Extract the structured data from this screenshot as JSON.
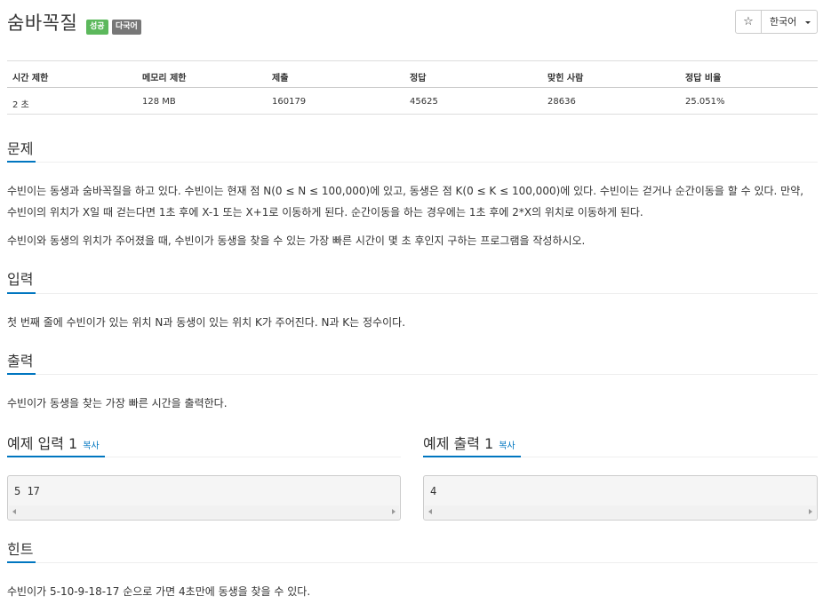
{
  "problem": {
    "title": "숨바꼭질",
    "badges": [
      "성공",
      "다국어"
    ]
  },
  "toolbar": {
    "star": "☆",
    "language": "한국어"
  },
  "stats": {
    "headers": [
      "시간 제한",
      "메모리 제한",
      "제출",
      "정답",
      "맞힌 사람",
      "정답 비율"
    ],
    "values": [
      "2 초",
      "128 MB",
      "160179",
      "45625",
      "28636",
      "25.051%"
    ]
  },
  "sections": {
    "description": {
      "heading": "문제",
      "p1_line1": "수빈이는 동생과 숨바꼭질을 하고 있다. 수빈이는 현재 점 N(0 ≤ N ≤ 100,000)에 있고, 동생은 점 K(0 ≤ K ≤ 100,000)에 있다. 수빈이는 걷거나 순간이동을 할 수 있다. 만약,",
      "p1_line2": "수빈이의 위치가 X일 때 걷는다면 1초 후에 X-1 또는 X+1로 이동하게 된다. 순간이동을 하는 경우에는 1초 후에 2*X의 위치로 이동하게 된다.",
      "p2": "수빈이와 동생의 위치가 주어졌을 때, 수빈이가 동생을 찾을 수 있는 가장 빠른 시간이 몇 초 후인지 구하는 프로그램을 작성하시오."
    },
    "input": {
      "heading": "입력",
      "text": "첫 번째 줄에 수빈이가 있는 위치 N과 동생이 있는 위치 K가 주어진다. N과 K는 정수이다."
    },
    "output": {
      "heading": "출력",
      "text": "수빈이가 동생을 찾는 가장 빠른 시간을 출력한다."
    },
    "hint": {
      "heading": "힌트",
      "text": "수빈이가 5-10-9-18-17 순으로 가면 4초만에 동생을 찾을 수 있다."
    }
  },
  "samples": {
    "input_title": "예제 입력 1",
    "output_title": "예제 출력 1",
    "copy_label": "복사",
    "input_value": "5 17",
    "output_value": "4"
  },
  "colors": {
    "accent": "#0076c0",
    "success_badge": "#5cb85c",
    "multilang_badge": "#777777"
  }
}
